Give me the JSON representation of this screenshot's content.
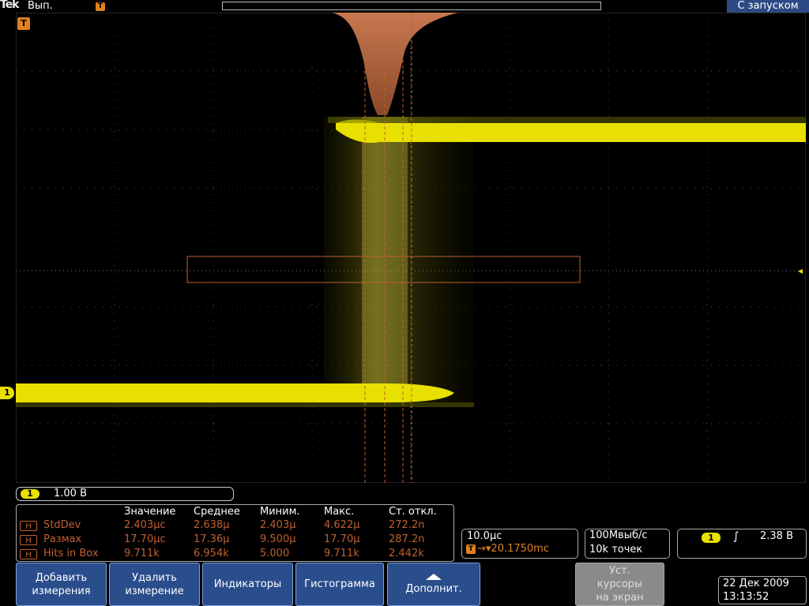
{
  "top_bar": {
    "logo": "Tek",
    "run_status": "Вып.",
    "trigger_marker": "T",
    "acq_mode": "С запуском"
  },
  "screen": {
    "trigger_position_marker": "T",
    "ch1_marker": "1",
    "trigger_level_marker": "◂"
  },
  "channel": {
    "badge": "1",
    "scale": "1.00 В"
  },
  "measurements": {
    "headers": [
      "Значение",
      "Среднее",
      "Миним.",
      "Макс.",
      "Ст. откл."
    ],
    "rows": [
      {
        "badge": "H",
        "name": "StdDev",
        "values": [
          "2.403µc",
          "2.638µ",
          "2.403µ",
          "4.622µ",
          "272.2n"
        ]
      },
      {
        "badge": "H",
        "name": "Размах",
        "values": [
          "17.70µc",
          "17.36µ",
          "9.500µ",
          "17.70µ",
          "287.2n"
        ]
      },
      {
        "badge": "H",
        "name": "Hits in Box",
        "values": [
          "9.711k",
          "6.954k",
          "5.000",
          "9.711k",
          "2.442k"
        ]
      }
    ]
  },
  "timebase": {
    "scale": "10.0µc",
    "delay_icon": "T",
    "delay": "→▾20.1750mc"
  },
  "acquisition": {
    "rate": "100Мвыб/с",
    "points": "10k точек"
  },
  "trigger": {
    "badge": "1",
    "slope_icon": "rising-edge-icon",
    "slope_glyph": "∫",
    "level": "2.38 В"
  },
  "buttons": {
    "add_measurement": [
      "Добавить",
      "измерения"
    ],
    "remove_measurement": [
      "Удалить",
      "измерение"
    ],
    "indicators": "Индикаторы",
    "histogram": "Гистограмма",
    "more": "Дополнит.",
    "set_cursors": [
      "Уст.",
      "курсоры",
      "на экран"
    ]
  },
  "datetime": {
    "date": "22 Дек 2009",
    "time": "13:13:52"
  },
  "colors": {
    "trace": "#e8e000",
    "histogram": "#c87850",
    "accent": "#2a4d8c",
    "trigger": "#e08020"
  }
}
